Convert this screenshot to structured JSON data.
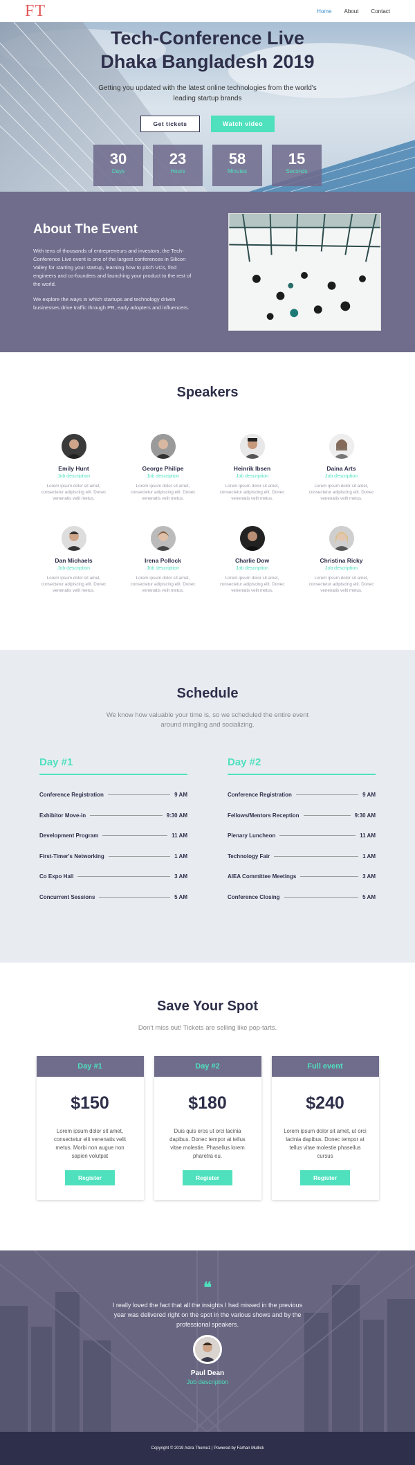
{
  "nav": {
    "logo": "FT",
    "links": [
      "Home",
      "About",
      "Contact"
    ]
  },
  "hero": {
    "title_line1": "Tech-Conference Live",
    "title_line2": "Dhaka Bangladesh 2019",
    "subtitle": "Getting you updated with the latest online technologies from the world's leading startup brands",
    "get_tickets": "Get tickets",
    "watch_video": "Watch video",
    "countdown": [
      {
        "num": "30",
        "label": "Days"
      },
      {
        "num": "23",
        "label": "Hours"
      },
      {
        "num": "58",
        "label": "Minutes"
      },
      {
        "num": "15",
        "label": "Seconds"
      }
    ]
  },
  "about": {
    "title": "About The Event",
    "p1": "With tens of thousands of entrepreneurs and investors, the Tech-Conference Live event is one of the largest conferences in Silicon Valley for starting your startup, learning how to pitch VCs, find engineers and co-founders and launching your product to the rest of the world.",
    "p2": "We explore the ways in which startups and technology driven businesses drive traffic through PR, early adopters and influencers."
  },
  "speakers": {
    "title": "Speakers",
    "items": [
      {
        "name": "Emily Hunt",
        "job": "Job description",
        "desc": "Lorem ipsum dolor sit amet, consectetur adipiscing elit. Donec venenatis velit metus."
      },
      {
        "name": "George Philipe",
        "job": "Job description",
        "desc": "Lorem ipsum dolor sit amet, consectetur adipiscing elit. Donec venenatis velit metus."
      },
      {
        "name": "Heinrik Ibsen",
        "job": "Job description",
        "desc": "Lorem ipsum dolor sit amet, consectetur adipiscing elit. Donec venenatis velit metus."
      },
      {
        "name": "Daina Arts",
        "job": "Job description",
        "desc": "Lorem ipsum dolor sit amet, consectetur adipiscing elit. Donec venenatis velit metus."
      },
      {
        "name": "Dan Michaels",
        "job": "Job description",
        "desc": "Lorem ipsum dolor sit amet, consectetur adipiscing elit. Donec venenatis velit metus."
      },
      {
        "name": "Irena Pollock",
        "job": "Job description",
        "desc": "Lorem ipsum dolor sit amet, consectetur adipiscing elit. Donec venenatis velit metus."
      },
      {
        "name": "Charlie Dow",
        "job": "Job description",
        "desc": "Lorem ipsum dolor sit amet, consectetur adipiscing elit. Donec venenatis velit metus."
      },
      {
        "name": "Christina Ricky",
        "job": "Job description",
        "desc": "Lorem ipsum dolor sit amet, consectetur adipiscing elit. Donec venenatis velit metus."
      }
    ]
  },
  "schedule": {
    "title": "Schedule",
    "lead": "We know how valuable your time is, so we scheduled the entire event around mingling and socializing.",
    "days": [
      {
        "title": "Day #1",
        "rows": [
          {
            "event": "Conference Registration",
            "time": "9 AM"
          },
          {
            "event": "Exhibitor Move-in",
            "time": "9:30 AM"
          },
          {
            "event": "Development Program",
            "time": "11 AM"
          },
          {
            "event": "First-Timer's Networking",
            "time": "1 AM"
          },
          {
            "event": "Co Expo Hall",
            "time": "3 AM"
          },
          {
            "event": "Concurrent Sessions",
            "time": "5 AM"
          }
        ]
      },
      {
        "title": "Day #2",
        "rows": [
          {
            "event": "Conference Registration",
            "time": "9 AM"
          },
          {
            "event": "Fellows/Mentors Reception",
            "time": "9:30 AM"
          },
          {
            "event": "Plenary Luncheon",
            "time": "11 AM"
          },
          {
            "event": "Technology Fair",
            "time": "1 AM"
          },
          {
            "event": "AIEA Committee Meetings",
            "time": "3 AM"
          },
          {
            "event": "Conference Closing",
            "time": "5 AM"
          }
        ]
      }
    ]
  },
  "pricing": {
    "title": "Save Your Spot",
    "lead": "Don't miss out! Tickets are selling like pop-tarts.",
    "cards": [
      {
        "head": "Day #1",
        "price": "$150",
        "desc": "Lorem ipsum dolor sit amet, consectetur elit venenatis velit metus. Morbi non augue non sapien volutpat",
        "btn": "Register"
      },
      {
        "head": "Day #2",
        "price": "$180",
        "desc": "Duis quis eros ut orci lacinia dapibus. Donec tempor at tellus vitae molestie. Phasellus lorem pharetra eu.",
        "btn": "Register"
      },
      {
        "head": "Full event",
        "price": "$240",
        "desc": "Lorem ipsum dolor sit amet, ut orci lacinia dapibus. Donec tempor at tellus vitae molestie phasellus cursus",
        "btn": "Register"
      }
    ]
  },
  "testimonial": {
    "quote_mark": "❝",
    "text": "I really loved the fact that all the insights I had missed in the previous year was delivered right on the spot in the various shows and by the professional speakers.",
    "name": "Paul Dean",
    "role": "Job description"
  },
  "footer": {
    "text": "Copyright © 2019 Astra Theme1 | Powered by Farhan Mullick"
  },
  "colors": {
    "accent": "#4fe0be",
    "dark": "#2e2f4a",
    "purple": "#706c8c"
  }
}
